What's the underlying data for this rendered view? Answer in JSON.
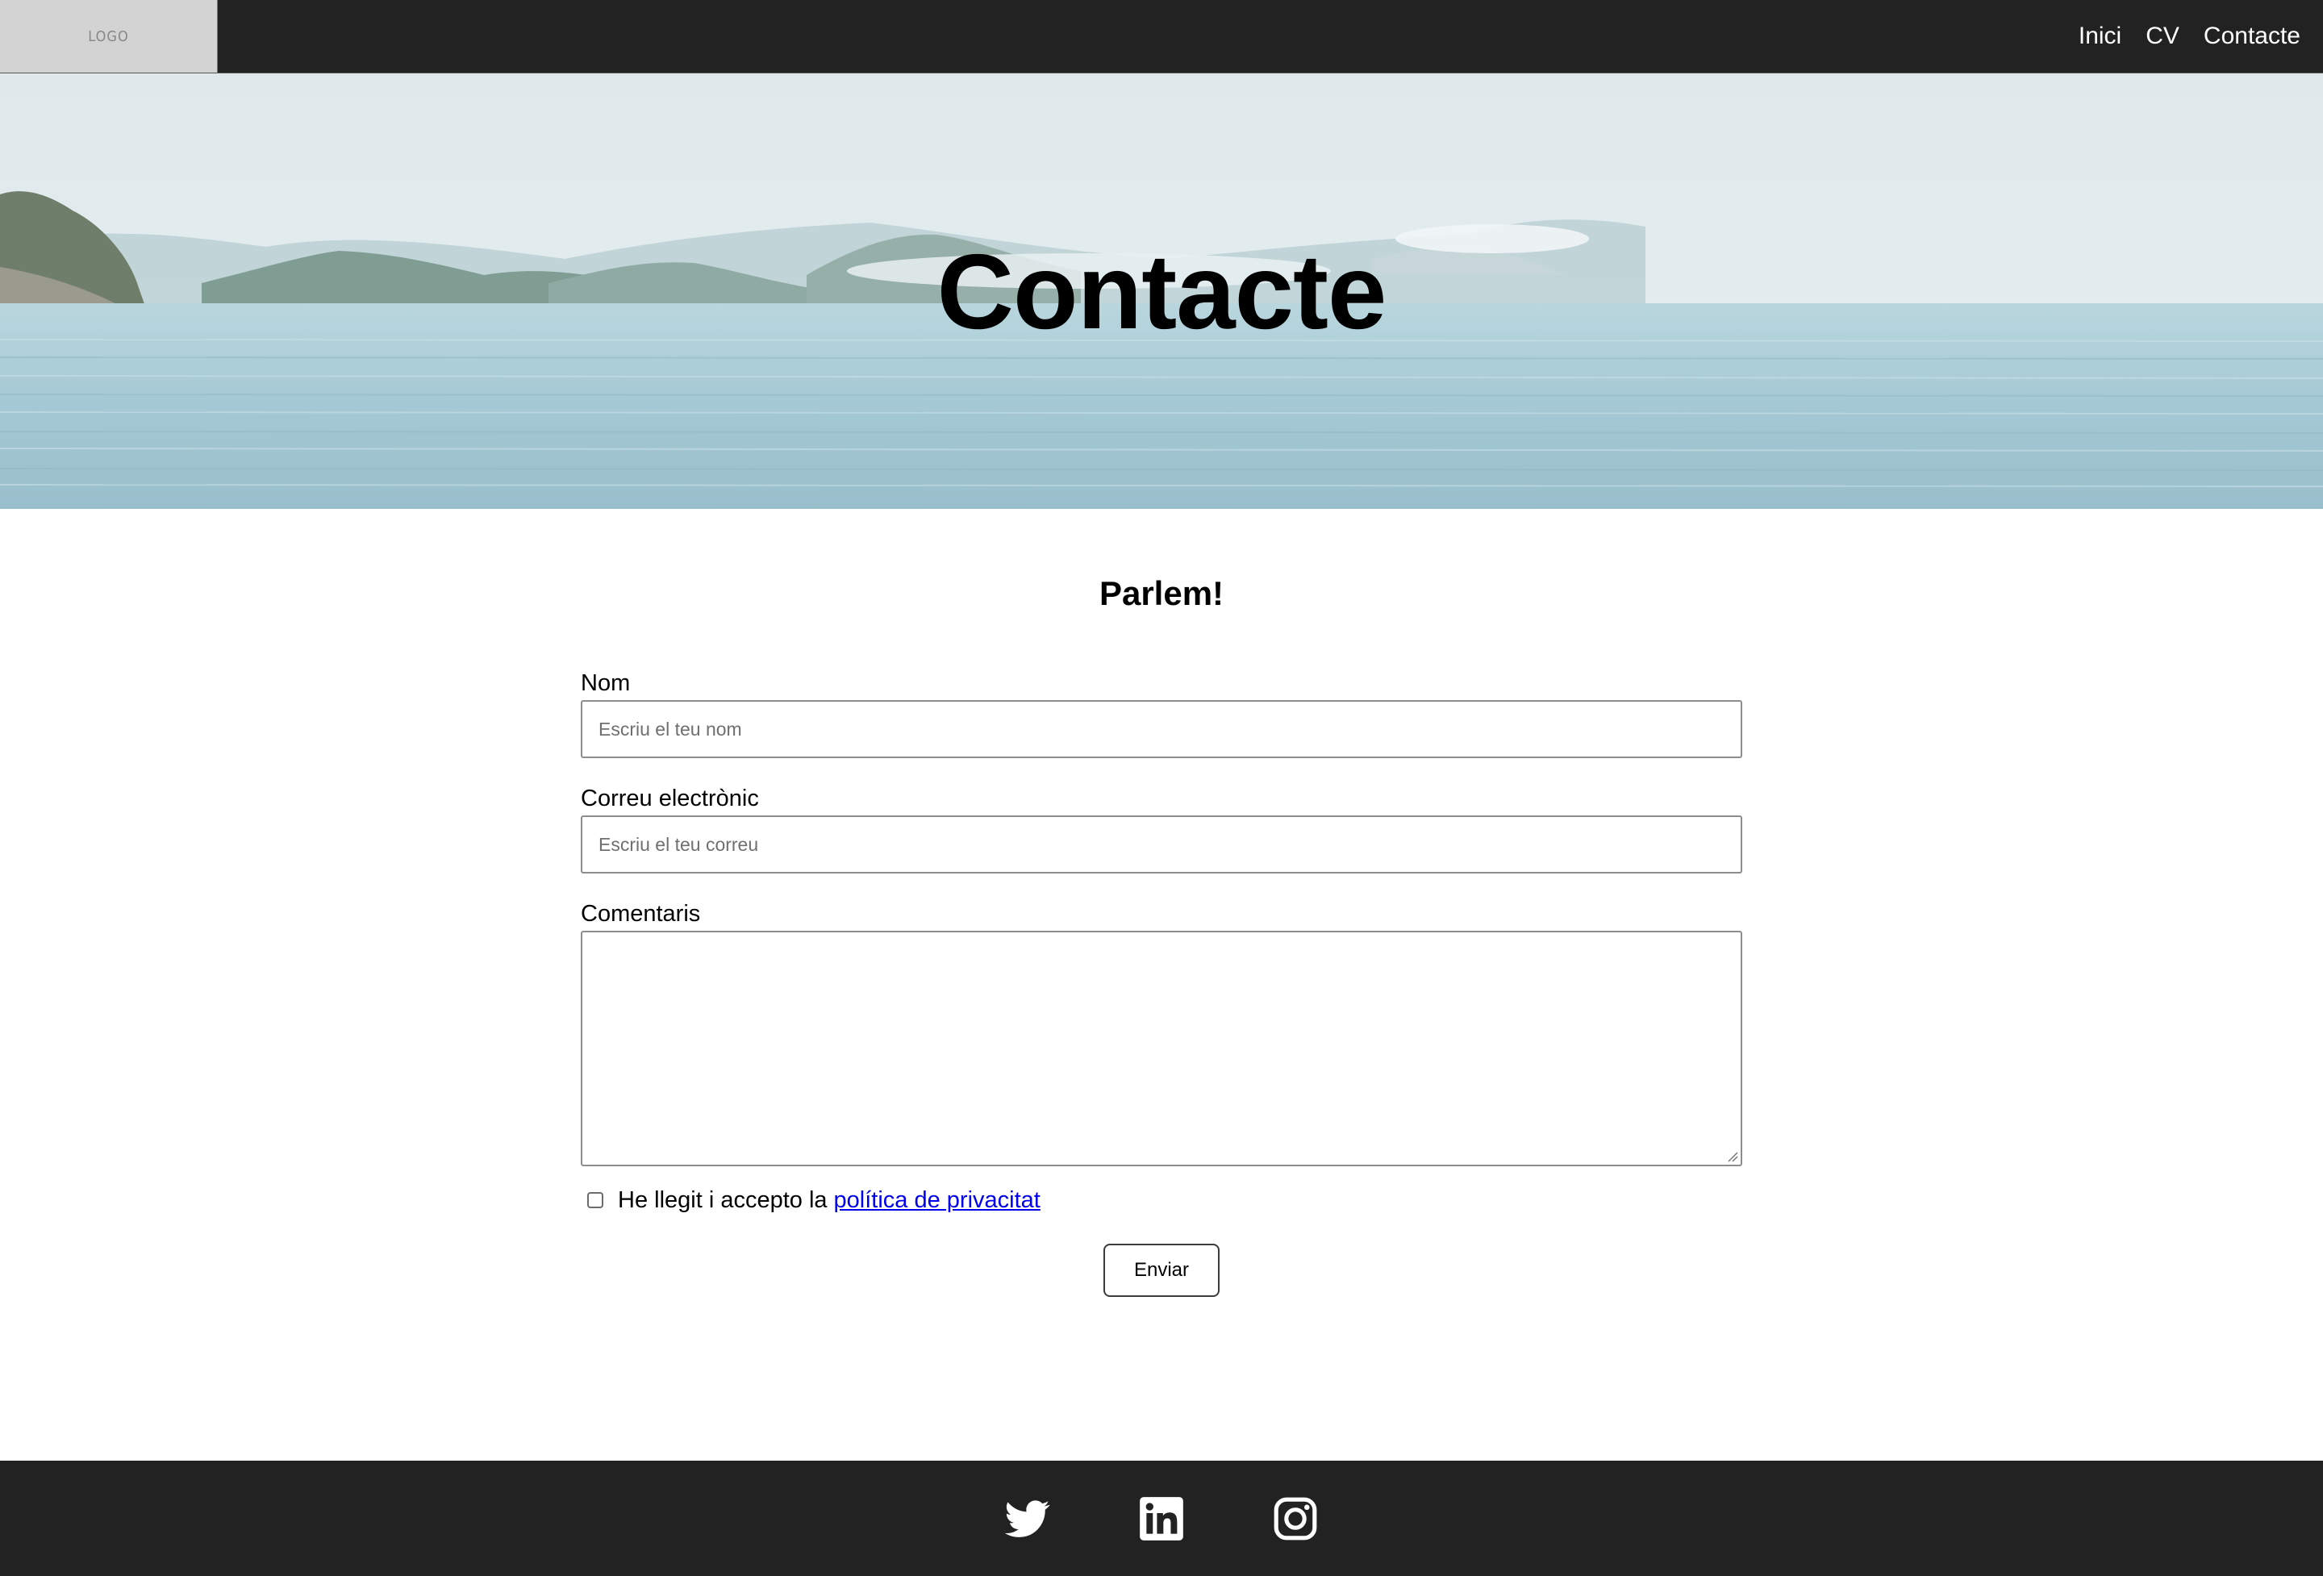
{
  "header": {
    "logo_text": "LOGO",
    "nav": [
      {
        "label": "Inici"
      },
      {
        "label": "CV"
      },
      {
        "label": "Contacte"
      }
    ]
  },
  "hero": {
    "title": "Contacte"
  },
  "form": {
    "heading": "Parlem!",
    "name_label": "Nom",
    "name_placeholder": "Escriu el teu nom",
    "email_label": "Correu electrònic",
    "email_placeholder": "Escriu el teu correu",
    "comments_label": "Comentaris",
    "consent_text": "He llegit i accepto la",
    "consent_link": "política de privacitat",
    "submit_label": "Enviar"
  },
  "footer": {
    "social_icons": [
      "twitter-icon",
      "linkedin-icon",
      "instagram-icon"
    ]
  },
  "colors": {
    "header_bg": "#222222",
    "footer_bg": "#222222",
    "link": "#0000ee",
    "sea": "#a9cdd6"
  }
}
